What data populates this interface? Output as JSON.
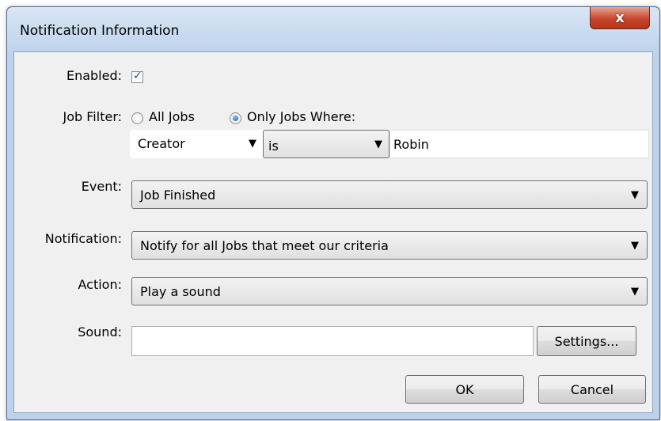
{
  "window": {
    "title": "Notification Information",
    "close_glyph": "x"
  },
  "enabled": {
    "label": "Enabled:",
    "checked": true,
    "check_glyph": "✓"
  },
  "job_filter": {
    "label": "Job Filter:",
    "option_all": "All Jobs",
    "option_where": "Only Jobs Where:",
    "selected": "Only Jobs Where:",
    "field": "Creator",
    "operator": "is",
    "value": "Robin",
    "arrow": "▼"
  },
  "event": {
    "label": "Event:",
    "value": "Job Finished"
  },
  "notification": {
    "label": "Notification:",
    "value": "Notify for all Jobs that meet our criteria"
  },
  "action": {
    "label": "Action:",
    "value": "Play a sound"
  },
  "sound": {
    "label": "Sound:",
    "value": "",
    "settings_label": "Settings..."
  },
  "buttons": {
    "ok": "OK",
    "cancel": "Cancel"
  }
}
